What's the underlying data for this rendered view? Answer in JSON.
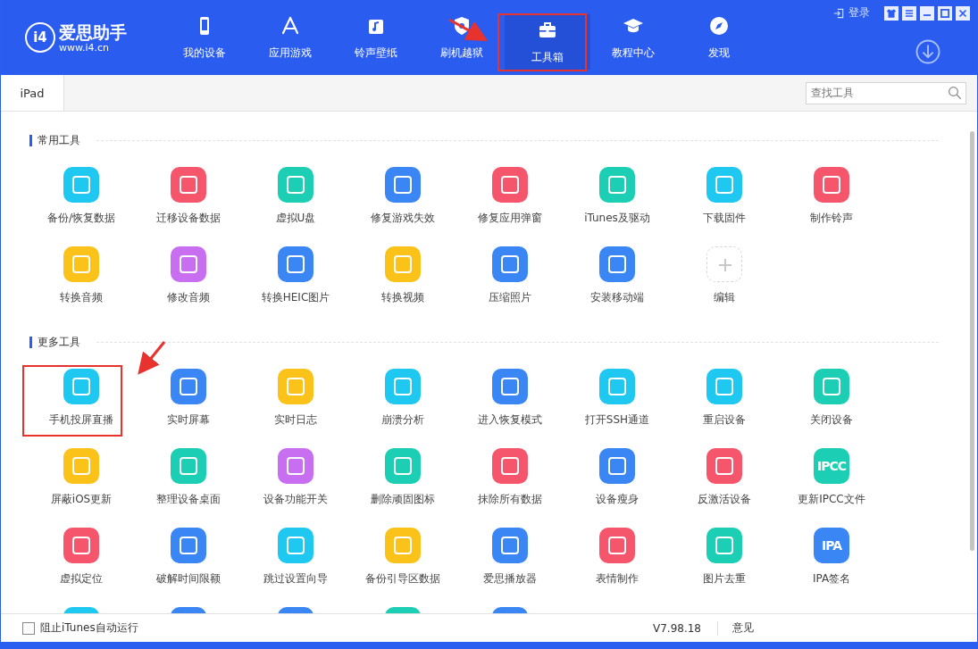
{
  "app": {
    "logo_mark": "i4",
    "logo_name": "爱思助手",
    "logo_url": "www.i4.cn"
  },
  "window_controls": {
    "login": "登录"
  },
  "nav": [
    {
      "label": "我的设备",
      "kind": "device",
      "selected": false
    },
    {
      "label": "应用游戏",
      "kind": "apps",
      "selected": false
    },
    {
      "label": "铃声壁纸",
      "kind": "music",
      "selected": false
    },
    {
      "label": "刷机越狱",
      "kind": "shield",
      "selected": false
    },
    {
      "label": "工具箱",
      "kind": "toolbox",
      "selected": true
    },
    {
      "label": "教程中心",
      "kind": "cap",
      "selected": false
    },
    {
      "label": "发现",
      "kind": "compass",
      "selected": false
    }
  ],
  "tabs": [
    {
      "label": "iPad",
      "selected": true
    }
  ],
  "search": {
    "placeholder": "查找工具"
  },
  "sections": [
    {
      "title": "常用工具",
      "tools": [
        {
          "label": "备份/恢复数据",
          "color": "#1fc8f0",
          "kind": "tool"
        },
        {
          "label": "迁移设备数据",
          "color": "#f5566c",
          "kind": "tool"
        },
        {
          "label": "虚拟U盘",
          "color": "#1ccfb4",
          "kind": "tool"
        },
        {
          "label": "修复游戏失效",
          "color": "#3b86f5",
          "kind": "tool"
        },
        {
          "label": "修复应用弹窗",
          "color": "#f5566c",
          "kind": "tool"
        },
        {
          "label": "iTunes及驱动",
          "color": "#1ccfb4",
          "kind": "tool"
        },
        {
          "label": "下载固件",
          "color": "#1fc8f0",
          "kind": "tool"
        },
        {
          "label": "制作铃声",
          "color": "#f5566c",
          "kind": "tool"
        },
        {
          "label": "转换音频",
          "color": "#fbc21a",
          "kind": "tool"
        },
        {
          "label": "修改音频",
          "color": "#c86ef0",
          "kind": "tool"
        },
        {
          "label": "转换HEIC图片",
          "color": "#3b86f5",
          "kind": "tool"
        },
        {
          "label": "转换视频",
          "color": "#fbc21a",
          "kind": "tool"
        },
        {
          "label": "压缩照片",
          "color": "#3b86f5",
          "kind": "tool"
        },
        {
          "label": "安装移动端",
          "color": "#3b86f5",
          "kind": "tool"
        },
        {
          "label": "编辑",
          "color": "#d8d8d8",
          "kind": "add"
        }
      ]
    },
    {
      "title": "更多工具",
      "tools": [
        {
          "label": "手机投屏直播",
          "color": "#1fc8f0",
          "kind": "tool"
        },
        {
          "label": "实时屏幕",
          "color": "#3b86f5",
          "kind": "tool"
        },
        {
          "label": "实时日志",
          "color": "#fbc21a",
          "kind": "tool"
        },
        {
          "label": "崩溃分析",
          "color": "#1fc8f0",
          "kind": "tool"
        },
        {
          "label": "进入恢复模式",
          "color": "#3b86f5",
          "kind": "tool"
        },
        {
          "label": "打开SSH通道",
          "color": "#1fc8f0",
          "kind": "tool"
        },
        {
          "label": "重启设备",
          "color": "#1fc8f0",
          "kind": "tool"
        },
        {
          "label": "关闭设备",
          "color": "#1ccfb4",
          "kind": "tool"
        },
        {
          "label": "屏蔽iOS更新",
          "color": "#fbc21a",
          "kind": "tool"
        },
        {
          "label": "整理设备桌面",
          "color": "#1ccfb4",
          "kind": "tool"
        },
        {
          "label": "设备功能开关",
          "color": "#c86ef0",
          "kind": "tool"
        },
        {
          "label": "删除顽固图标",
          "color": "#1ccfb4",
          "kind": "tool"
        },
        {
          "label": "抹除所有数据",
          "color": "#f5566c",
          "kind": "tool"
        },
        {
          "label": "设备瘦身",
          "color": "#3b86f5",
          "kind": "tool"
        },
        {
          "label": "反激活设备",
          "color": "#f5566c",
          "kind": "tool"
        },
        {
          "label": "更新IPCC文件",
          "color": "#1ccfb4",
          "kind": "text",
          "glyph": "IPCC"
        },
        {
          "label": "虚拟定位",
          "color": "#f5566c",
          "kind": "tool"
        },
        {
          "label": "破解时间限额",
          "color": "#3b86f5",
          "kind": "tool"
        },
        {
          "label": "跳过设置向导",
          "color": "#1fc8f0",
          "kind": "tool"
        },
        {
          "label": "备份引导区数据",
          "color": "#fbc21a",
          "kind": "tool"
        },
        {
          "label": "爱思播放器",
          "color": "#3b86f5",
          "kind": "tool"
        },
        {
          "label": "表情制作",
          "color": "#f5566c",
          "kind": "tool"
        },
        {
          "label": "图片去重",
          "color": "#1ccfb4",
          "kind": "tool"
        },
        {
          "label": "IPA签名",
          "color": "#3b86f5",
          "kind": "text",
          "glyph": "IPA"
        }
      ],
      "cut_off_icons": [
        {
          "color": "#1fc8f0"
        },
        {
          "color": "#3b86f5"
        },
        {
          "color": "#3b86f5"
        },
        {
          "color": "#1ccfb4"
        },
        {
          "color": "#3b86f5"
        }
      ]
    }
  ],
  "footer": {
    "checkbox": {
      "label": "阻止iTunes自动运行",
      "checked": false
    },
    "version": "V7.98.18",
    "feedback": "意见"
  }
}
